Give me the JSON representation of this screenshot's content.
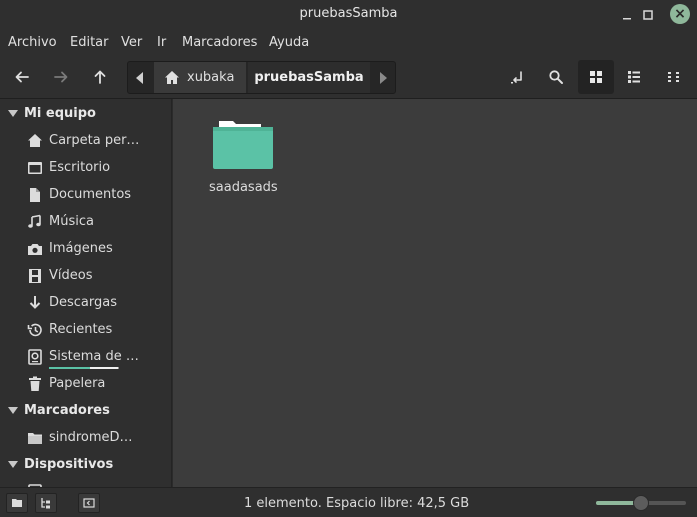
{
  "window": {
    "title": "pruebasSamba",
    "minimize_glyph": "_",
    "maximize_glyph": "□",
    "close_glyph": "×"
  },
  "menu": {
    "items": [
      "Archivo",
      "Editar",
      "Ver",
      "Ir",
      "Marcadores",
      "Ayuda"
    ]
  },
  "toolbar": {
    "back_icon": "arrow-left-icon",
    "forward_icon": "arrow-right-icon",
    "up_icon": "arrow-up-icon",
    "toggle_location_icon": "location-toggle-icon",
    "search_icon": "search-icon",
    "view_icons": "icon-view-icon",
    "view_list": "list-view-icon",
    "view_compact": "compact-view-icon",
    "active_view": "icons"
  },
  "pathbar": {
    "crumbs": [
      {
        "label": "xubaka",
        "icon": "home-icon"
      },
      {
        "label": "pruebasSamba",
        "current": true
      }
    ]
  },
  "sidebar": {
    "sections": [
      {
        "title": "Mi equipo",
        "items": [
          {
            "label": "Carpeta per…",
            "icon": "home-icon"
          },
          {
            "label": "Escritorio",
            "icon": "desktop-icon"
          },
          {
            "label": "Documentos",
            "icon": "document-icon"
          },
          {
            "label": "Música",
            "icon": "music-icon"
          },
          {
            "label": "Imágenes",
            "icon": "camera-icon"
          },
          {
            "label": "Vídeos",
            "icon": "film-icon"
          },
          {
            "label": "Descargas",
            "icon": "download-icon"
          },
          {
            "label": "Recientes",
            "icon": "history-icon"
          },
          {
            "label": "Sistema de …",
            "icon": "drive-icon"
          },
          {
            "label": "Papelera",
            "icon": "trash-icon"
          }
        ]
      },
      {
        "title": "Marcadores",
        "items": [
          {
            "label": "sindromeD…",
            "icon": "folder-icon"
          }
        ]
      },
      {
        "title": "Dispositivos",
        "items": []
      }
    ]
  },
  "files": [
    {
      "name": "saadasads",
      "type": "folder",
      "color": "#5bc2a6"
    }
  ],
  "statusbar": {
    "text": "1  elemento. Espacio libre: 42,5 GB",
    "zoom_fraction": 0.5,
    "accent": "#8fb89b"
  }
}
